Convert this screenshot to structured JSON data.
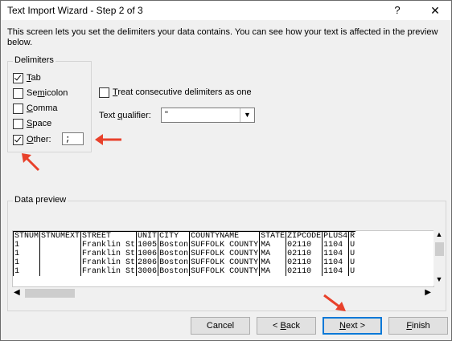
{
  "window": {
    "title": "Text Import Wizard - Step 2 of 3",
    "help": "?",
    "close": "✕"
  },
  "intro": "This screen lets you set the delimiters your data contains.  You can see how your text is affected in the preview below.",
  "delimiters": {
    "legend": "Delimiters",
    "tab": {
      "pre": "",
      "u": "T",
      "post": "ab",
      "checked": true
    },
    "semicolon": {
      "pre": "Se",
      "u": "m",
      "post": "icolon",
      "checked": false
    },
    "comma": {
      "pre": "",
      "u": "C",
      "post": "omma",
      "checked": false
    },
    "space": {
      "pre": "",
      "u": "S",
      "post": "pace",
      "checked": false
    },
    "other": {
      "pre": "",
      "u": "O",
      "post": "ther:",
      "checked": true,
      "value": ";"
    }
  },
  "consecutive": {
    "pre": "",
    "u": "T",
    "post": "reat consecutive delimiters as one",
    "checked": false
  },
  "qualifier": {
    "pre": "Text ",
    "u": "q",
    "post": "ualifier:",
    "value": "\""
  },
  "preview": {
    "legend": "Data preview",
    "rows": [
      [
        "STNUM",
        "STNUMEXT",
        "STREET",
        "UNIT",
        "CITY",
        "COUNTYNAME",
        "STATE",
        "ZIPCODE",
        "PLUS4",
        "R"
      ],
      [
        "1",
        "",
        "Franklin St",
        "1005",
        "Boston",
        "SUFFOLK COUNTY",
        "MA",
        "02110",
        "1104",
        "U"
      ],
      [
        "1",
        "",
        "Franklin St",
        "1006",
        "Boston",
        "SUFFOLK COUNTY",
        "MA",
        "02110",
        "1104",
        "U"
      ],
      [
        "1",
        "",
        "Franklin St",
        "2806",
        "Boston",
        "SUFFOLK COUNTY",
        "MA",
        "02110",
        "1104",
        "U"
      ],
      [
        "1",
        "",
        "Franklin St",
        "3006",
        "Boston",
        "SUFFOLK COUNTY",
        "MA",
        "02110",
        "1104",
        "U"
      ]
    ]
  },
  "buttons": {
    "cancel": {
      "label": "Cancel"
    },
    "back": {
      "pre": "< ",
      "u": "B",
      "post": "ack"
    },
    "next": {
      "pre": "",
      "u": "N",
      "post": "ext >"
    },
    "finish": {
      "pre": "",
      "u": "F",
      "post": "inish"
    }
  },
  "colors": {
    "arrow": "#e8412b",
    "default_button_border": "#0078d7"
  }
}
